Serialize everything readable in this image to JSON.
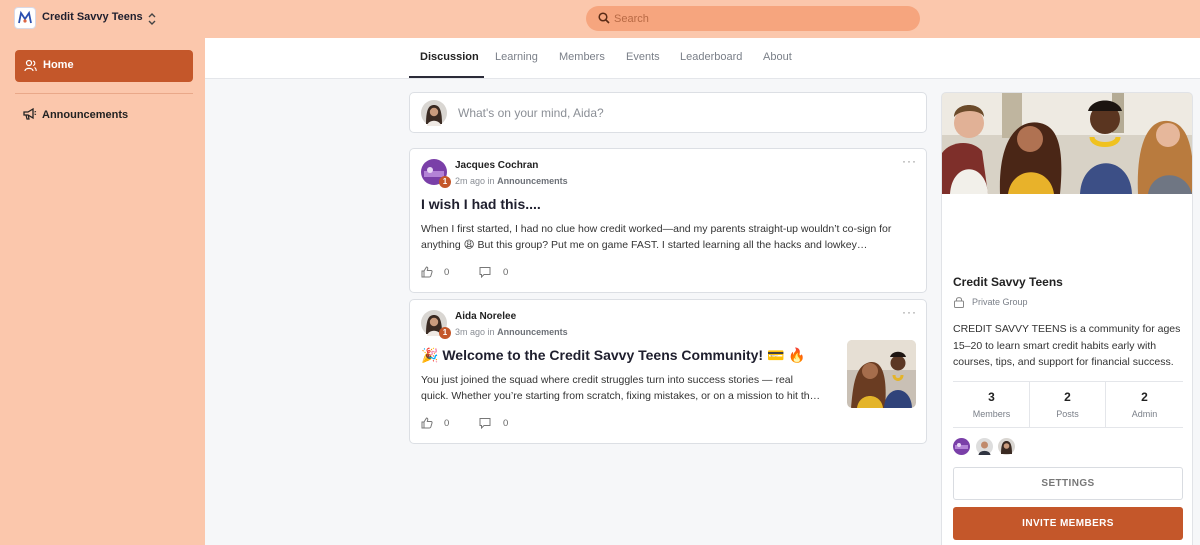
{
  "app": {
    "name": "Credit Savvy Teens"
  },
  "search": {
    "placeholder": "Search"
  },
  "sidebar": {
    "items": [
      {
        "label": "Home",
        "icon": "users-icon",
        "active": true
      },
      {
        "label": "Announcements",
        "icon": "megaphone-icon",
        "active": false
      }
    ]
  },
  "tabs": [
    {
      "label": "Discussion",
      "active": true
    },
    {
      "label": "Learning"
    },
    {
      "label": "Members"
    },
    {
      "label": "Events"
    },
    {
      "label": "Leaderboard"
    },
    {
      "label": "About"
    }
  ],
  "composer": {
    "placeholder": "What's on your mind, Aida?"
  },
  "posts": [
    {
      "author": "Jacques Cochran",
      "level": "1",
      "time": "2m ago",
      "in_word": "in",
      "category": "Announcements",
      "title": "I wish I had this....",
      "body_line1": "When I first started, I had no clue how credit worked—and my parents straight-up wouldn’t co-sign for",
      "body_line2": "anything 😩  But this group? Put me on game FAST. I started learning all the hacks and lowkey…",
      "likes": "0",
      "comments": "0"
    },
    {
      "author": "Aida Norelee",
      "level": "1",
      "time": "3m ago",
      "in_word": "in",
      "category": "Announcements",
      "title": "🎉  Welcome to the Credit Savvy Teens Community! 💳 🔥",
      "body_line1": "You just joined the squad where credit struggles turn into success stories — real",
      "body_line2": "quick. Whether you’re starting from scratch, fixing mistakes, or on a mission to hit th…",
      "likes": "0",
      "comments": "0"
    }
  ],
  "group": {
    "name": "Credit Savvy Teens",
    "privacy": "Private Group",
    "description": "CREDIT SAVVY TEENS is a community for ages 15–20 to learn smart credit habits early with courses, tips, and support for financial success.",
    "stats": [
      {
        "value": "3",
        "label": "Members"
      },
      {
        "value": "2",
        "label": "Posts"
      },
      {
        "value": "2",
        "label": "Admin"
      }
    ],
    "settings_label": "SETTINGS",
    "invite_label": "INVITE MEMBERS"
  },
  "colors": {
    "accent": "#c4572a",
    "sidebar": "#fbc7ac",
    "search": "#f6a57e"
  }
}
